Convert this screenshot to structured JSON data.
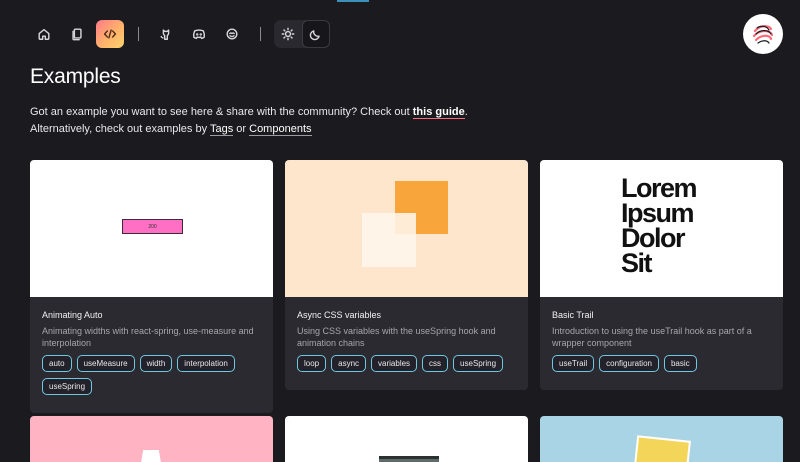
{
  "nav": {
    "items": [
      {
        "name": "home-icon"
      },
      {
        "name": "docs-icon"
      },
      {
        "name": "code-icon",
        "active": true
      },
      {
        "name": "github-icon"
      },
      {
        "name": "discord-icon"
      },
      {
        "name": "opencollective-icon"
      }
    ],
    "theme": {
      "light_icon": "sun-icon",
      "dark_icon": "moon-icon",
      "selected": "dark"
    }
  },
  "page": {
    "title": "Examples",
    "intro_line1_prefix": "Got an example you want to see here & share with the community? Check out ",
    "intro_guide_link": "this guide",
    "intro_line1_suffix": ".",
    "intro_line2_prefix": "Alternatively, check out examples by ",
    "intro_tags_link": "Tags",
    "intro_or": " or ",
    "intro_components_link": "Components"
  },
  "cards": [
    {
      "title": "Animating Auto",
      "description": "Animating widths with react-spring, use-measure and interpolation",
      "thumb_label": "200",
      "tags": [
        "auto",
        "useMeasure",
        "width",
        "interpolation",
        "useSpring"
      ]
    },
    {
      "title": "Async CSS variables",
      "description": "Using CSS variables with the useSpring hook and animation chains",
      "tags": [
        "loop",
        "async",
        "variables",
        "css",
        "useSpring"
      ]
    },
    {
      "title": "Basic Trail",
      "description": "Introduction to using the useTrail hook as part of a wrapper component",
      "thumb_words": [
        "Lorem",
        "Ipsum",
        "Dolor",
        "Sit"
      ],
      "tags": [
        "useTrail",
        "configuration",
        "basic"
      ]
    }
  ],
  "colors": {
    "background": "#1b1a1f",
    "card": "#2b2a31",
    "tag_border": "#6fc7e0",
    "guide_underline": "#ff6b7a"
  }
}
